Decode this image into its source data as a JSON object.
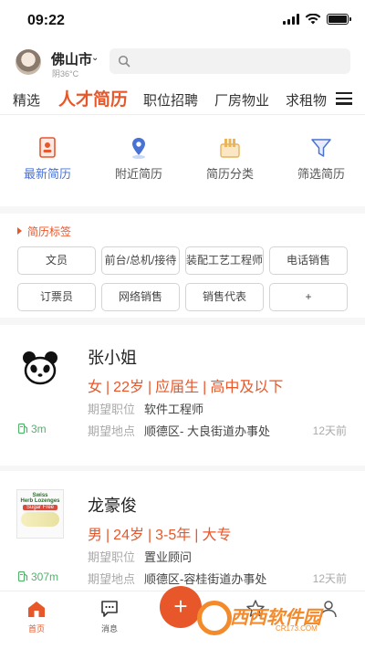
{
  "status_bar": {
    "time": "09:22"
  },
  "header": {
    "city": "佛山市",
    "temperature": "阴36°C"
  },
  "tabs": [
    "精选",
    "人才简历",
    "职位招聘",
    "厂房物业",
    "求租物"
  ],
  "features": [
    {
      "label": "最新简历",
      "icon": "resume-icon",
      "active": true
    },
    {
      "label": "附近简历",
      "icon": "location-pin-icon",
      "active": false
    },
    {
      "label": "简历分类",
      "icon": "category-icon",
      "active": false
    },
    {
      "label": "筛选简历",
      "icon": "filter-icon",
      "active": false
    }
  ],
  "tags": {
    "title": "简历标签",
    "items": [
      "文员",
      "前台/总机/接待",
      "装配工艺工程师",
      "电话销售",
      "订票员",
      "网络销售",
      "销售代表",
      "+"
    ]
  },
  "resumes": [
    {
      "name": "张小姐",
      "gender": "女",
      "age": "22岁",
      "experience": "应届生",
      "education": "高中及以下",
      "position_label": "期望职位",
      "position": "软件工程师",
      "location_label": "期望地点",
      "location": "顺德区- 大良街道办事处",
      "distance": "3m",
      "time_ago": "12天前",
      "photo": "panda-avatar"
    },
    {
      "name": "龙豪俊",
      "gender": "男",
      "age": "24岁",
      "experience": "3-5年",
      "education": "大专",
      "position_label": "期望职位",
      "position": "置业顾问",
      "location_label": "期望地点",
      "location": "顺德区-容桂街道办事处",
      "distance": "307m",
      "time_ago": "12天前",
      "photo": "product-box-photo",
      "photo_text": [
        "Swiss",
        "Herb Lozenges",
        "Sugar Free"
      ]
    }
  ],
  "bottom_nav": [
    {
      "label": "首页",
      "icon": "home-icon",
      "active": true
    },
    {
      "label": "消息",
      "icon": "message-icon",
      "active": false
    },
    {
      "label": "",
      "icon": "plus-icon",
      "active": false
    },
    {
      "label": "",
      "icon": "star-icon",
      "active": false
    },
    {
      "label": "",
      "icon": "user-icon",
      "active": false
    }
  ],
  "watermark": {
    "brand": "西西软件园",
    "url": "CR173.COM"
  },
  "colors": {
    "accent": "#e8572a",
    "active_blue": "#4a72d4",
    "distance_green": "#53b26c"
  }
}
